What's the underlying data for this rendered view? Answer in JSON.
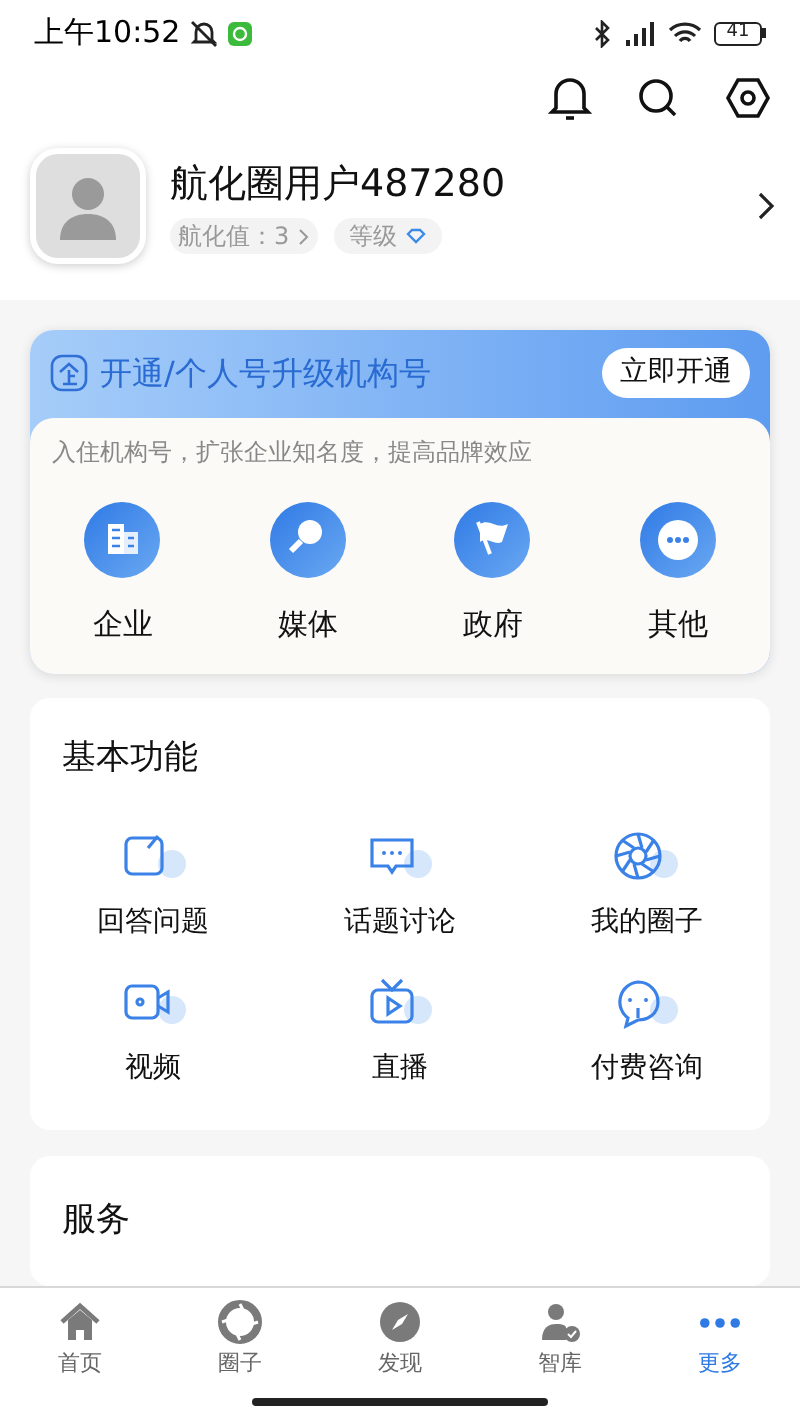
{
  "status_bar": {
    "time": "上午10:52",
    "battery": "41"
  },
  "profile": {
    "name": "航化圈用户487280",
    "score_label": "航化值：3",
    "level_label": "等级"
  },
  "org_card": {
    "title": "开通/个人号升级机构号",
    "button": "立即开通",
    "subtitle": "入住机构号，扩张企业知名度，提高品牌效应",
    "items": [
      {
        "kind": "enterprise",
        "label": "企业"
      },
      {
        "kind": "media",
        "label": "媒体"
      },
      {
        "kind": "government",
        "label": "政府"
      },
      {
        "kind": "other",
        "label": "其他"
      }
    ]
  },
  "basic": {
    "title": "基本功能",
    "items": [
      {
        "kind": "answer",
        "label": "回答问题"
      },
      {
        "kind": "topic",
        "label": "话题讨论"
      },
      {
        "kind": "circle",
        "label": "我的圈子"
      },
      {
        "kind": "video",
        "label": "视频"
      },
      {
        "kind": "live",
        "label": "直播"
      },
      {
        "kind": "consult",
        "label": "付费咨询"
      }
    ]
  },
  "services": {
    "title": "服务"
  },
  "tab_bar": [
    {
      "kind": "home",
      "label": "首页",
      "selected": false
    },
    {
      "kind": "circle",
      "label": "圈子",
      "selected": false
    },
    {
      "kind": "discover",
      "label": "发现",
      "selected": false
    },
    {
      "kind": "library",
      "label": "智库",
      "selected": false
    },
    {
      "kind": "more",
      "label": "更多",
      "selected": true
    }
  ]
}
